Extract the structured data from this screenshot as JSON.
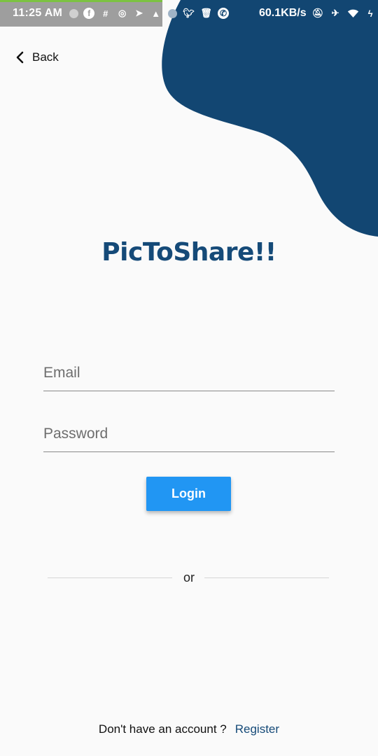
{
  "status_bar": {
    "time": "11:25 AM",
    "net_speed": "60.1KB/s",
    "icons": [
      "circle-icon",
      "facebook-icon",
      "slack-icon",
      "instagram-icon",
      "telegram-icon",
      "alert-icon",
      "circle-icon",
      "twitter-icon",
      "trash-icon",
      "whatsapp-icon",
      "bell-off-icon",
      "airplane-icon",
      "wifi-icon",
      "charging-icon"
    ]
  },
  "nav": {
    "back_label": "Back"
  },
  "brand": {
    "title": "PicToShare!!",
    "color": "#154a78"
  },
  "form": {
    "email_placeholder": "Email",
    "password_placeholder": "Password",
    "login_label": "Login"
  },
  "divider": {
    "label": "or"
  },
  "footer": {
    "prompt": "Don't have an account ?",
    "register_label": "Register"
  },
  "colors": {
    "accent": "#2196f3",
    "brand": "#154a78"
  }
}
